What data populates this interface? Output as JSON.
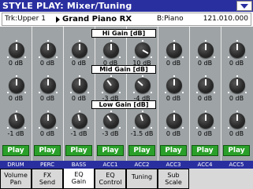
{
  "title": "STYLE PLAY: Mixer/Tuning",
  "track": "Trk:Upper 1",
  "sound": "Grand Piano RX",
  "bank": "B:Piano",
  "program_number": "121.010.000",
  "sections": {
    "hi": "Hi Gain [dB]",
    "mid": "Mid Gain [dB]",
    "low": "Low Gain [dB]"
  },
  "hi_values": [
    "0 dB",
    "0 dB",
    "0 dB",
    "0 dB",
    "10 dB",
    "0 dB",
    "0 dB",
    "0 dB"
  ],
  "mid_values": [
    "0 dB",
    "0 dB",
    "0 dB",
    "-3 dB",
    "-4 dB",
    "0 dB",
    "0 dB",
    "0 dB"
  ],
  "low_values": [
    "-1 dB",
    "0 dB",
    "-1 dB",
    "-3 dB",
    "-1.5 dB",
    "0 dB",
    "0 dB",
    "0 dB"
  ],
  "play_label": "Play",
  "channels": [
    "DRUM",
    "PERC",
    "BASS",
    "ACC1",
    "ACC2",
    "ACC3",
    "ACC4",
    "ACC5"
  ],
  "tabs": [
    {
      "line1": "Volume",
      "line2": "Pan"
    },
    {
      "line1": "FX",
      "line2": "Send"
    },
    {
      "line1": "EQ",
      "line2": "Gain"
    },
    {
      "line1": "EQ",
      "line2": "Control"
    },
    {
      "line1": "Tuning",
      "line2": ""
    },
    {
      "line1": "Sub",
      "line2": "Scale"
    }
  ],
  "active_tab": "EQ Gain",
  "colors": {
    "title_bar": "#2a2fa0",
    "mixer_bg": "#9ea3a5",
    "play_button": "#2aa02a"
  },
  "icons": [
    "menu-arrow-icon",
    "track-arrow-icon",
    "knob-icon"
  ]
}
